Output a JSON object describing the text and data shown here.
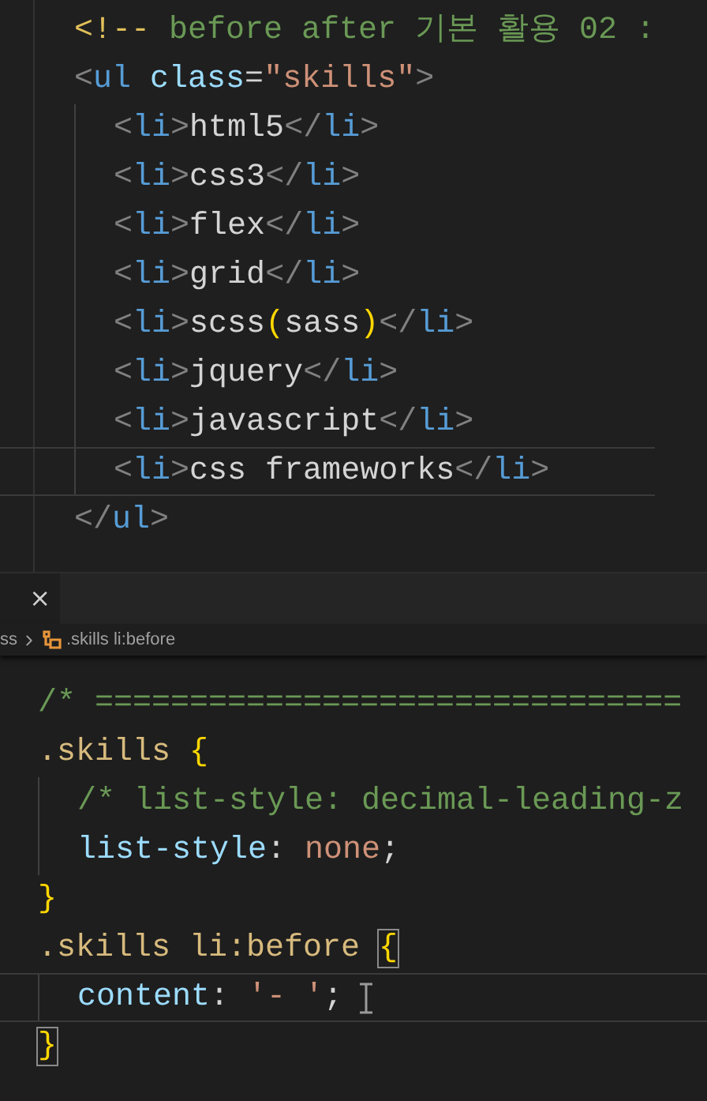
{
  "top_editor": {
    "lines": [
      {
        "current": false,
        "pointer": false,
        "tokens": [
          {
            "kind": "comment_punct",
            "text": "<!--"
          },
          {
            "kind": "comment",
            "text": " before after 기본 활용 02 :"
          }
        ]
      },
      {
        "current": false,
        "pointer": false,
        "tokens": [
          {
            "kind": "punct",
            "text": "<"
          },
          {
            "kind": "tag",
            "text": "ul"
          },
          {
            "kind": "attr",
            "text": " class"
          },
          {
            "kind": "text",
            "text": "="
          },
          {
            "kind": "string",
            "text": "\"skills\""
          },
          {
            "kind": "punct",
            "text": ">"
          }
        ],
        "children": [
          {
            "current": false,
            "pointer": false,
            "tokens": [
              {
                "kind": "punct",
                "text": "<"
              },
              {
                "kind": "tag",
                "text": "li"
              },
              {
                "kind": "punct",
                "text": ">"
              },
              {
                "kind": "text",
                "text": "html5"
              },
              {
                "kind": "punct",
                "text": "</"
              },
              {
                "kind": "tag",
                "text": "li"
              },
              {
                "kind": "punct",
                "text": ">"
              }
            ]
          },
          {
            "current": false,
            "pointer": false,
            "tokens": [
              {
                "kind": "punct",
                "text": "<"
              },
              {
                "kind": "tag",
                "text": "li"
              },
              {
                "kind": "punct",
                "text": ">"
              },
              {
                "kind": "text",
                "text": "css3"
              },
              {
                "kind": "punct",
                "text": "</"
              },
              {
                "kind": "tag",
                "text": "li"
              },
              {
                "kind": "punct",
                "text": ">"
              }
            ]
          },
          {
            "current": false,
            "pointer": false,
            "tokens": [
              {
                "kind": "punct",
                "text": "<"
              },
              {
                "kind": "tag",
                "text": "li"
              },
              {
                "kind": "punct",
                "text": ">"
              },
              {
                "kind": "text",
                "text": "flex"
              },
              {
                "kind": "punct",
                "text": "</"
              },
              {
                "kind": "tag",
                "text": "li"
              },
              {
                "kind": "punct",
                "text": ">"
              }
            ]
          },
          {
            "current": false,
            "pointer": false,
            "tokens": [
              {
                "kind": "punct",
                "text": "<"
              },
              {
                "kind": "tag",
                "text": "li"
              },
              {
                "kind": "punct",
                "text": ">"
              },
              {
                "kind": "text",
                "text": "grid"
              },
              {
                "kind": "punct",
                "text": "</"
              },
              {
                "kind": "tag",
                "text": "li"
              },
              {
                "kind": "punct",
                "text": ">"
              }
            ]
          },
          {
            "current": false,
            "pointer": false,
            "tokens": [
              {
                "kind": "punct",
                "text": "<"
              },
              {
                "kind": "tag",
                "text": "li"
              },
              {
                "kind": "punct",
                "text": ">"
              },
              {
                "kind": "text",
                "text": "scss"
              },
              {
                "kind": "bracket",
                "text": "("
              },
              {
                "kind": "text",
                "text": "sass"
              },
              {
                "kind": "bracket",
                "text": ")"
              },
              {
                "kind": "punct",
                "text": "</"
              },
              {
                "kind": "tag",
                "text": "li"
              },
              {
                "kind": "punct",
                "text": ">"
              }
            ]
          },
          {
            "current": false,
            "pointer": false,
            "tokens": [
              {
                "kind": "punct",
                "text": "<"
              },
              {
                "kind": "tag",
                "text": "li"
              },
              {
                "kind": "punct",
                "text": ">"
              },
              {
                "kind": "text",
                "text": "jquery"
              },
              {
                "kind": "punct",
                "text": "</"
              },
              {
                "kind": "tag",
                "text": "li"
              },
              {
                "kind": "punct",
                "text": ">"
              }
            ]
          },
          {
            "current": false,
            "pointer": false,
            "tokens": [
              {
                "kind": "punct",
                "text": "<"
              },
              {
                "kind": "tag",
                "text": "li"
              },
              {
                "kind": "punct",
                "text": ">"
              },
              {
                "kind": "text",
                "text": "javascript"
              },
              {
                "kind": "punct",
                "text": "</"
              },
              {
                "kind": "tag",
                "text": "li"
              },
              {
                "kind": "punct",
                "text": ">"
              }
            ]
          },
          {
            "current": true,
            "pointer": false,
            "tokens": [
              {
                "kind": "punct",
                "text": "<"
              },
              {
                "kind": "tag",
                "text": "li"
              },
              {
                "kind": "punct",
                "text": ">"
              },
              {
                "kind": "text",
                "text": "css frameworks"
              },
              {
                "kind": "punct",
                "text": "</"
              },
              {
                "kind": "tag",
                "text": "li"
              },
              {
                "kind": "punct",
                "text": ">"
              }
            ]
          }
        ]
      },
      {
        "current": false,
        "pointer": false,
        "tokens": [
          {
            "kind": "punct",
            "text": "</"
          },
          {
            "kind": "tag",
            "text": "ul"
          },
          {
            "kind": "punct",
            "text": ">"
          }
        ]
      }
    ]
  },
  "tab": {
    "close": "×"
  },
  "breadcrumb": [
    {
      "kind": "file",
      "label": "ss"
    },
    {
      "kind": "selector",
      "label": ".skills li:before"
    }
  ],
  "bottom_editor": {
    "lines": [
      {
        "current": false,
        "pointer": false,
        "tokens": [
          {
            "kind": "comment",
            "text": "/* ==============================="
          }
        ]
      },
      {
        "current": false,
        "pointer": false,
        "tokens": [
          {
            "kind": "selector",
            "text": ".skills "
          },
          {
            "kind": "bracket",
            "text": "{"
          }
        ],
        "children": [
          {
            "current": false,
            "pointer": false,
            "tokens": [
              {
                "kind": "comment",
                "text": "/* list-style: decimal-leading-z"
              }
            ]
          },
          {
            "current": false,
            "pointer": false,
            "tokens": [
              {
                "kind": "property",
                "text": "list-style"
              },
              {
                "kind": "text",
                "text": ": "
              },
              {
                "kind": "value",
                "text": "none"
              },
              {
                "kind": "text",
                "text": ";"
              }
            ]
          }
        ]
      },
      {
        "current": false,
        "pointer": false,
        "tokens": [
          {
            "kind": "bracket",
            "text": "}"
          }
        ]
      },
      {
        "current": false,
        "pointer": false,
        "tokens": [
          {
            "kind": "selector",
            "text": ".skills li:before "
          },
          {
            "kind": "bracket_match",
            "text": "{"
          }
        ],
        "children": [
          {
            "current": true,
            "pointer": true,
            "tokens": [
              {
                "kind": "property",
                "text": "content"
              },
              {
                "kind": "text",
                "text": ": "
              },
              {
                "kind": "value",
                "text": "'- '"
              },
              {
                "kind": "text",
                "text": ";"
              }
            ]
          }
        ]
      },
      {
        "current": false,
        "pointer": false,
        "tokens": [
          {
            "kind": "bracket_match",
            "text": "}"
          }
        ]
      }
    ]
  }
}
